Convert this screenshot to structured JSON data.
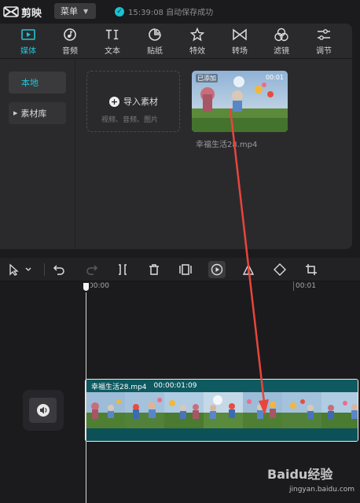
{
  "app": {
    "name": "剪映"
  },
  "titlebar": {
    "menu_label": "菜单",
    "save_status": "15:39:08 自动保存成功"
  },
  "tabs": [
    {
      "label": "媒体",
      "icon": "media-icon",
      "active": true
    },
    {
      "label": "音频",
      "icon": "audio-icon"
    },
    {
      "label": "文本",
      "icon": "text-icon"
    },
    {
      "label": "贴纸",
      "icon": "sticker-icon"
    },
    {
      "label": "特效",
      "icon": "effects-icon"
    },
    {
      "label": "转场",
      "icon": "transition-icon"
    },
    {
      "label": "滤镜",
      "icon": "filter-icon"
    },
    {
      "label": "调节",
      "icon": "adjust-icon"
    }
  ],
  "sidebar": {
    "local_label": "本地",
    "library_label": "素材库"
  },
  "import": {
    "label": "导入素材",
    "hint": "视频、音频、图片"
  },
  "media_item": {
    "badge": "已添加",
    "duration": "00:01",
    "filename": "幸福生活28.mp4"
  },
  "toolbar": {
    "tools": [
      "select-icon",
      "undo-icon",
      "redo-icon",
      "split-icon",
      "delete-icon",
      "freeze-icon",
      "play-reverse-icon",
      "mirror-icon",
      "rotate-icon",
      "crop-icon"
    ]
  },
  "timeline": {
    "ruler_start": "00:00",
    "ruler_end": "00:01",
    "clip": {
      "name": "幸福生活28.mp4",
      "duration": "00:00:01:09"
    }
  },
  "watermark": {
    "brand": "Baidu经验",
    "url": "jingyan.baidu.com"
  },
  "colors": {
    "accent": "#1fc6d4",
    "clip": "#0e5b62",
    "arrow": "#e8453c"
  }
}
